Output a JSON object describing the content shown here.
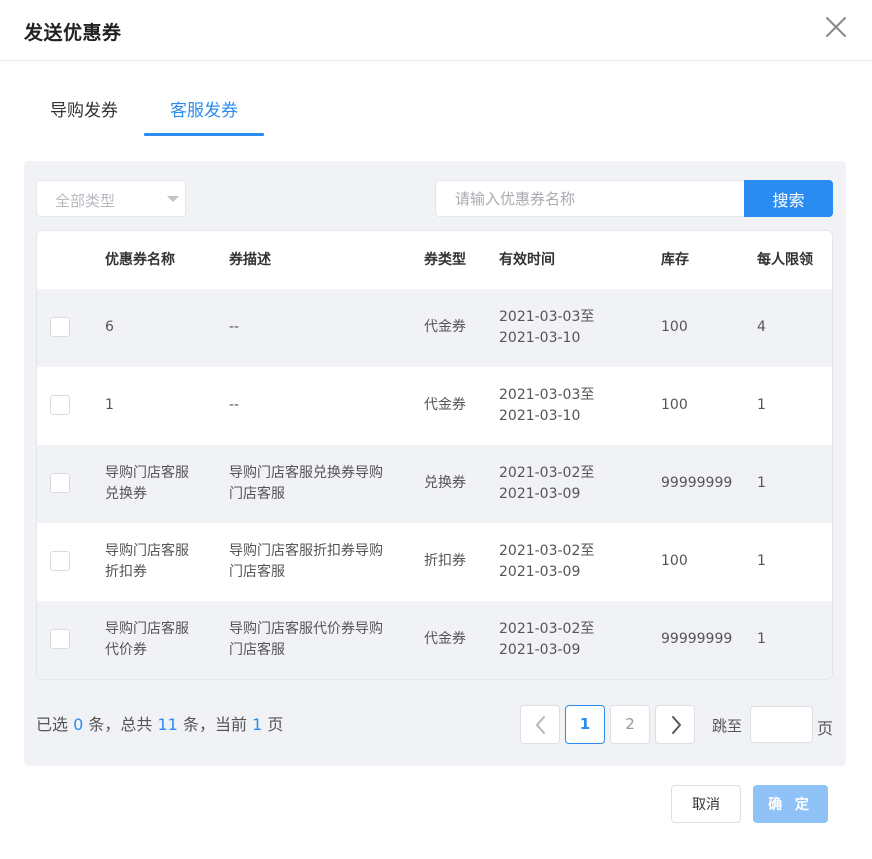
{
  "dialog": {
    "title": "发送优惠券",
    "close_icon": "close-icon"
  },
  "tabs": [
    {
      "label": "导购发券",
      "active": false
    },
    {
      "label": "客服发券",
      "active": true
    }
  ],
  "filter": {
    "type_select": "全部类型",
    "search_placeholder": "请输入优惠券名称",
    "search_button": "搜索"
  },
  "table": {
    "headers": [
      "优惠券名称",
      "券描述",
      "券类型",
      "有效时间",
      "库存",
      "每人限领"
    ],
    "rows": [
      {
        "name_l1": "6",
        "name_l2": "",
        "desc_l1": "--",
        "desc_l2": "",
        "type": "代金券",
        "time_l1": "2021-03-03至",
        "time_l2": "2021-03-10",
        "stock": "100",
        "limit": "4"
      },
      {
        "name_l1": "1",
        "name_l2": "",
        "desc_l1": "--",
        "desc_l2": "",
        "type": "代金券",
        "time_l1": "2021-03-03至",
        "time_l2": "2021-03-10",
        "stock": "100",
        "limit": "1"
      },
      {
        "name_l1": "导购门店客服",
        "name_l2": "兑换券",
        "desc_l1": "导购门店客服兑换券导购",
        "desc_l2": "门店客服",
        "type": "兑换券",
        "time_l1": "2021-03-02至",
        "time_l2": "2021-03-09",
        "stock": "99999999",
        "limit": "1"
      },
      {
        "name_l1": "导购门店客服",
        "name_l2": "折扣券",
        "desc_l1": "导购门店客服折扣券导购",
        "desc_l2": "门店客服",
        "type": "折扣券",
        "time_l1": "2021-03-02至",
        "time_l2": "2021-03-09",
        "stock": "100",
        "limit": "1"
      },
      {
        "name_l1": "导购门店客服",
        "name_l2": "代价券",
        "desc_l1": "导购门店客服代价券导购",
        "desc_l2": "门店客服",
        "type": "代金券",
        "time_l1": "2021-03-02至",
        "time_l2": "2021-03-09",
        "stock": "99999999",
        "limit": "1"
      }
    ]
  },
  "summary": {
    "p1": "已选",
    "selected": "0",
    "p2": "条，总共",
    "total": "11",
    "p3": "条，当前",
    "current": "1",
    "p4": "页"
  },
  "pagination": {
    "pages": [
      "1",
      "2"
    ],
    "jump_label": "跳至",
    "jump_unit": "页",
    "jump_value": ""
  },
  "actions": {
    "cancel": "取消",
    "confirm": "确 定"
  },
  "colors": {
    "accent": "#2a8cf0",
    "panel_bg": "#f1f2f6",
    "confirm_disabled": "#8fc2f7"
  }
}
